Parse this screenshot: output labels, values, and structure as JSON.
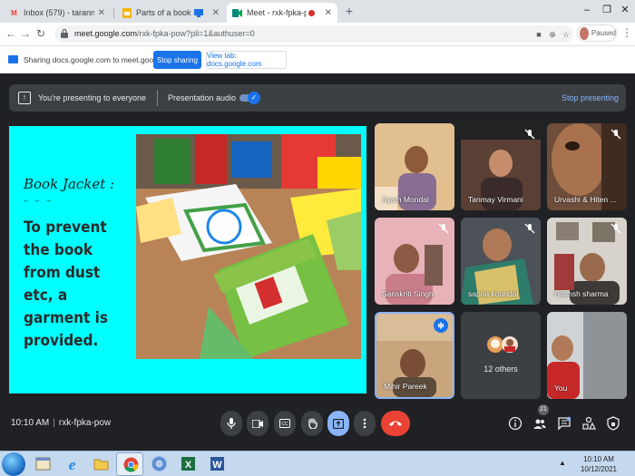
{
  "browser": {
    "tabs": [
      {
        "title": "Inbox (579) - tarannum@theind",
        "favicon": "gmail-icon",
        "color": "#ea4335",
        "active": false
      },
      {
        "title": "Parts of a book - Google Slid",
        "favicon": "google-slides-icon",
        "color": "#f4b400",
        "active": false
      },
      {
        "title": "Meet - rxk-fpka-pow",
        "favicon": "google-meet-icon",
        "color": "#00897b",
        "active": true
      }
    ],
    "url_host": "meet.google.com",
    "url_path": "/rxk-fpka-pow?pli=1&authuser=0",
    "profile_status": "Paused"
  },
  "sharing_bar": {
    "text": "Sharing docs.google.com to meet.google.com",
    "stop_sharing": "Stop sharing",
    "view_tab": "View tab: docs.google.com"
  },
  "presenting": {
    "message": "You're presenting to everyone",
    "audio_label": "Presentation audio",
    "audio_enabled": true,
    "stop_label": "Stop presenting"
  },
  "slide": {
    "heading": "Book Jacket :",
    "rule": "– – –",
    "body": "To prevent the book from dust etc, a garment is provided."
  },
  "participants": [
    {
      "name": "Ayam Mondal",
      "muted": false
    },
    {
      "name": "Tanmay Virmani",
      "muted": true
    },
    {
      "name": "Urvashi & Hiten ...",
      "muted": true
    },
    {
      "name": "Sanskriti Singh",
      "muted": true
    },
    {
      "name": "sapna koundal",
      "muted": true
    },
    {
      "name": "Hitansh sharma",
      "muted": true
    },
    {
      "name": "Mihir Pareek",
      "muted": false,
      "speaking": true
    },
    {
      "name": "You",
      "muted": false
    }
  ],
  "others": {
    "label": "12 others"
  },
  "meeting": {
    "time": "10:10 AM",
    "code": "rxk-fpka-pow",
    "participant_count": "21"
  },
  "taskbar": {
    "time": "10:10 AM",
    "date": "10/12/2021"
  },
  "colors": {
    "slide_bg": "#00ffff",
    "meet_bg": "#202124",
    "accent_blue": "#1a73e8",
    "end_call_red": "#ea4335"
  }
}
